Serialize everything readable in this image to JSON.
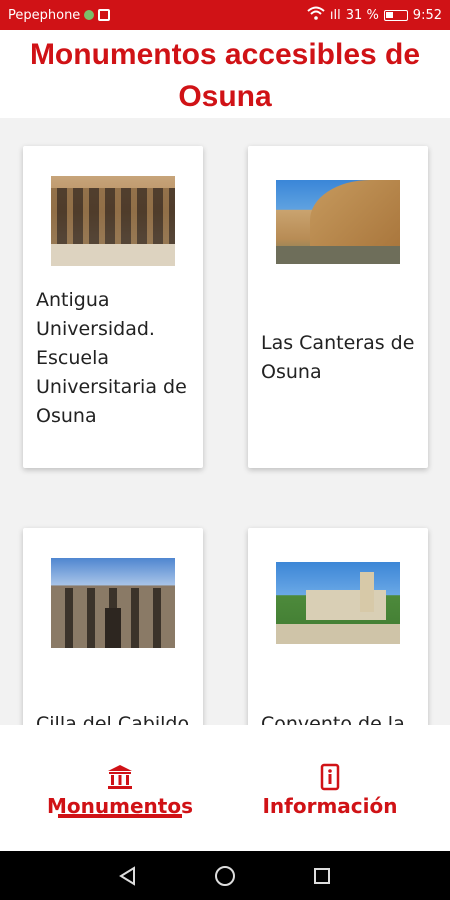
{
  "status_bar": {
    "carrier": "Pepephone",
    "battery_percent": "31 %",
    "signal_text": "ıll",
    "time": "9:52"
  },
  "header": {
    "title_line1": "Monumentos accesibles de",
    "title_line2": "Osuna"
  },
  "cards": [
    {
      "label_lines": [
        "Antigua",
        "Universidad.",
        "Escuela",
        "Universitaria de",
        "Osuna"
      ]
    },
    {
      "label_lines": [
        "Las Canteras de",
        "Osuna"
      ]
    },
    {
      "label_lines": [
        "Cilla del Cabildo"
      ]
    },
    {
      "label_lines": [
        "Convento de la"
      ]
    }
  ],
  "bottom_nav": {
    "monumentos_label": "Monumentos",
    "informacion_label": "Información"
  },
  "colors": {
    "accent": "#d01216",
    "background": "#f2f2f2"
  },
  "icons": {
    "monumentos": "museum-icon",
    "informacion": "info-icon",
    "back": "back-triangle-icon",
    "home": "home-circle-icon",
    "recents": "recents-square-icon"
  }
}
